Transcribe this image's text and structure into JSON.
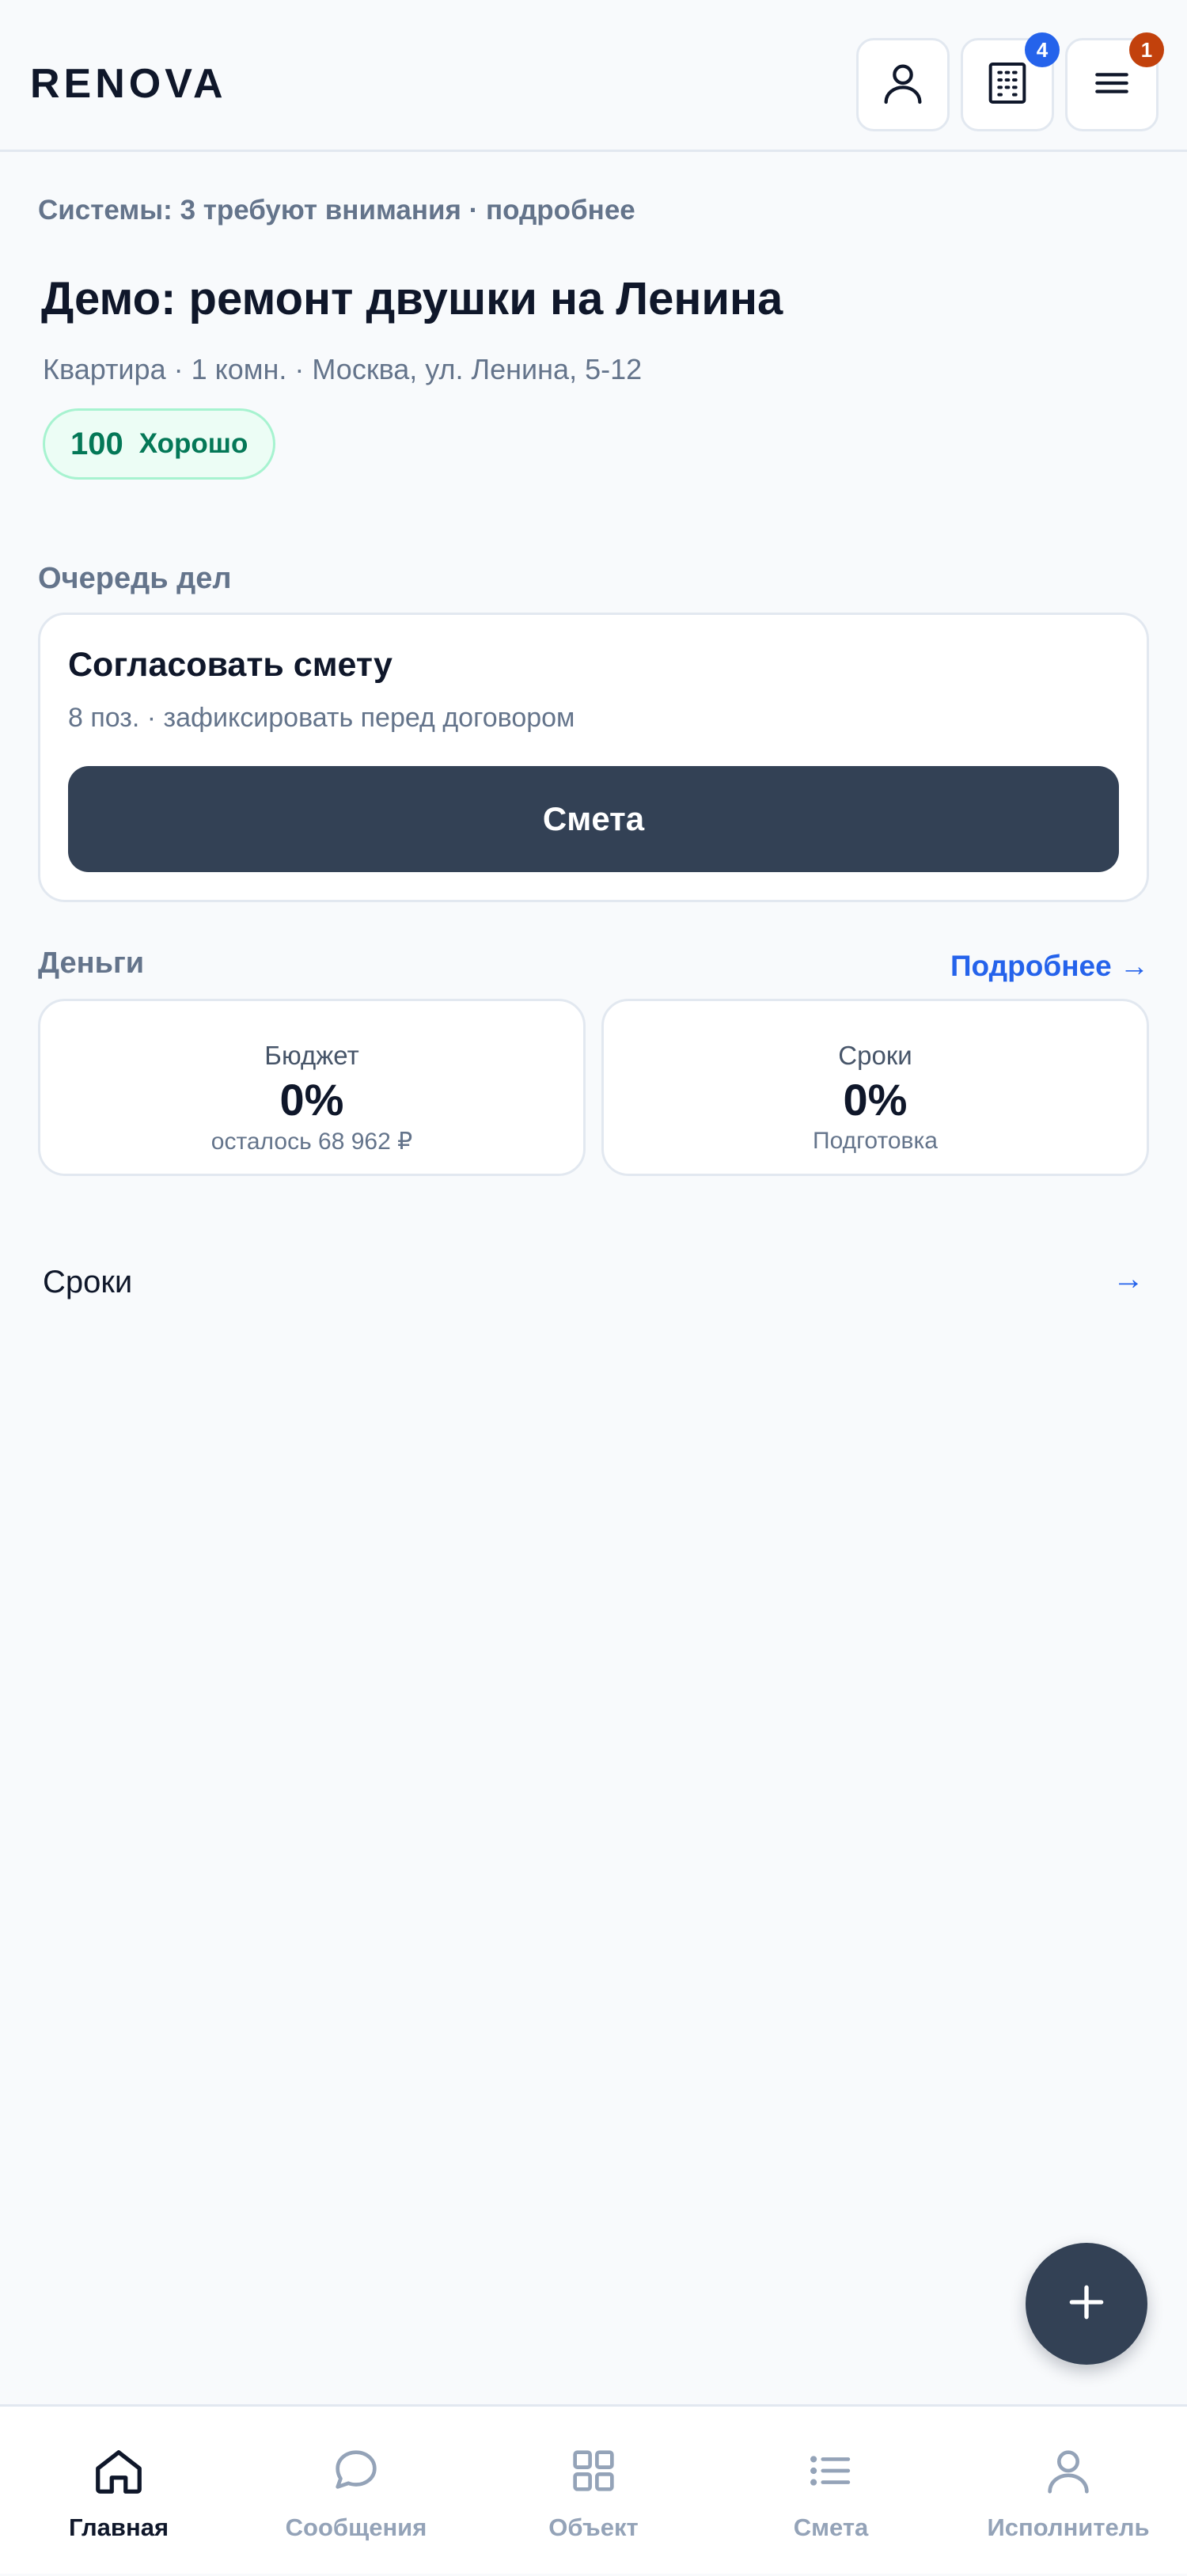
{
  "header": {
    "logo": "RENOVA",
    "buttons": [
      {
        "name": "profile",
        "icon": "user-icon"
      },
      {
        "name": "objects",
        "icon": "building-icon",
        "badge": "4"
      },
      {
        "name": "menu",
        "icon": "menu-icon",
        "badge": "1"
      }
    ]
  },
  "systems_link": "Системы: 3 требуют внимания · подробнее",
  "project": {
    "title": "Демо: ремонт двушки на Ленина",
    "subtitle": "Квартира · 1 комн. · Москва, ул. Ленина, 5-12",
    "score": "100",
    "score_label": "Хорошо"
  },
  "queue": {
    "label": "Очередь дел",
    "task_title": "Согласовать смету",
    "task_sub": "8 поз. · зафиксировать перед договором",
    "task_button": "Смета"
  },
  "money": {
    "label": "Деньги",
    "more_link": "Подробнее →",
    "cards": [
      {
        "label": "Бюджет",
        "value": "0%",
        "sub": "осталось 68 962 ₽"
      },
      {
        "label": "Сроки",
        "value": "0%",
        "sub": "Подготовка"
      }
    ]
  },
  "timeline_row": {
    "title": "Сроки",
    "arrow": "→"
  },
  "fab": {
    "icon": "plus-icon"
  },
  "bottom_nav": [
    {
      "label": "Главная",
      "icon": "home-icon",
      "active": true
    },
    {
      "label": "Сообщения",
      "icon": "chat-icon",
      "active": false
    },
    {
      "label": "Объект",
      "icon": "grid-icon",
      "active": false
    },
    {
      "label": "Смета",
      "icon": "list-icon",
      "active": false
    },
    {
      "label": "Исполнитель",
      "icon": "user-icon",
      "active": false
    }
  ],
  "colors": {
    "background": "#f8fafc",
    "primary_dark": "#334155",
    "accent_blue": "#2563eb",
    "badge_orange": "#c2410c",
    "success_green": "#047857"
  }
}
